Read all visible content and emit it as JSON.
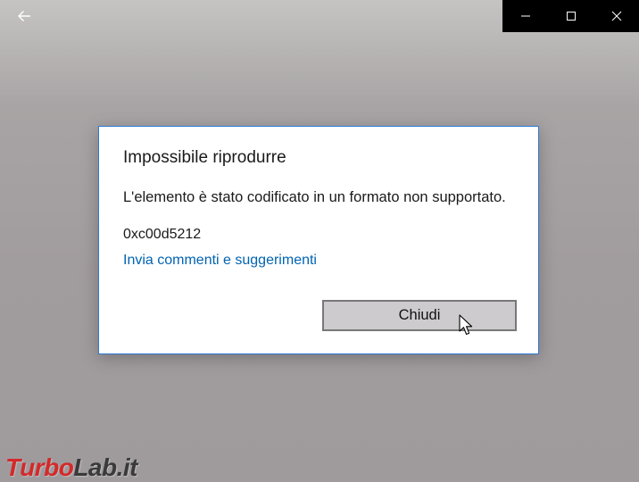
{
  "titlebar": {
    "back_icon": "back-arrow-icon",
    "controls": {
      "minimize_icon": "minimize-icon",
      "maximize_icon": "maximize-icon",
      "close_icon": "close-icon"
    }
  },
  "dialog": {
    "title": "Impossibile riprodurre",
    "message": "L'elemento è stato codificato in un formato non supportato.",
    "error_code": "0xc00d5212",
    "feedback_link": "Invia commenti e suggerimenti",
    "close_label": "Chiudi"
  },
  "watermark": {
    "part1": "Turbo",
    "part2": "Lab.it"
  },
  "colors": {
    "dialog_border": "#2b79d3",
    "link": "#0063b1",
    "button_bg": "#cdcbcd",
    "watermark_red": "#d32a2a"
  }
}
